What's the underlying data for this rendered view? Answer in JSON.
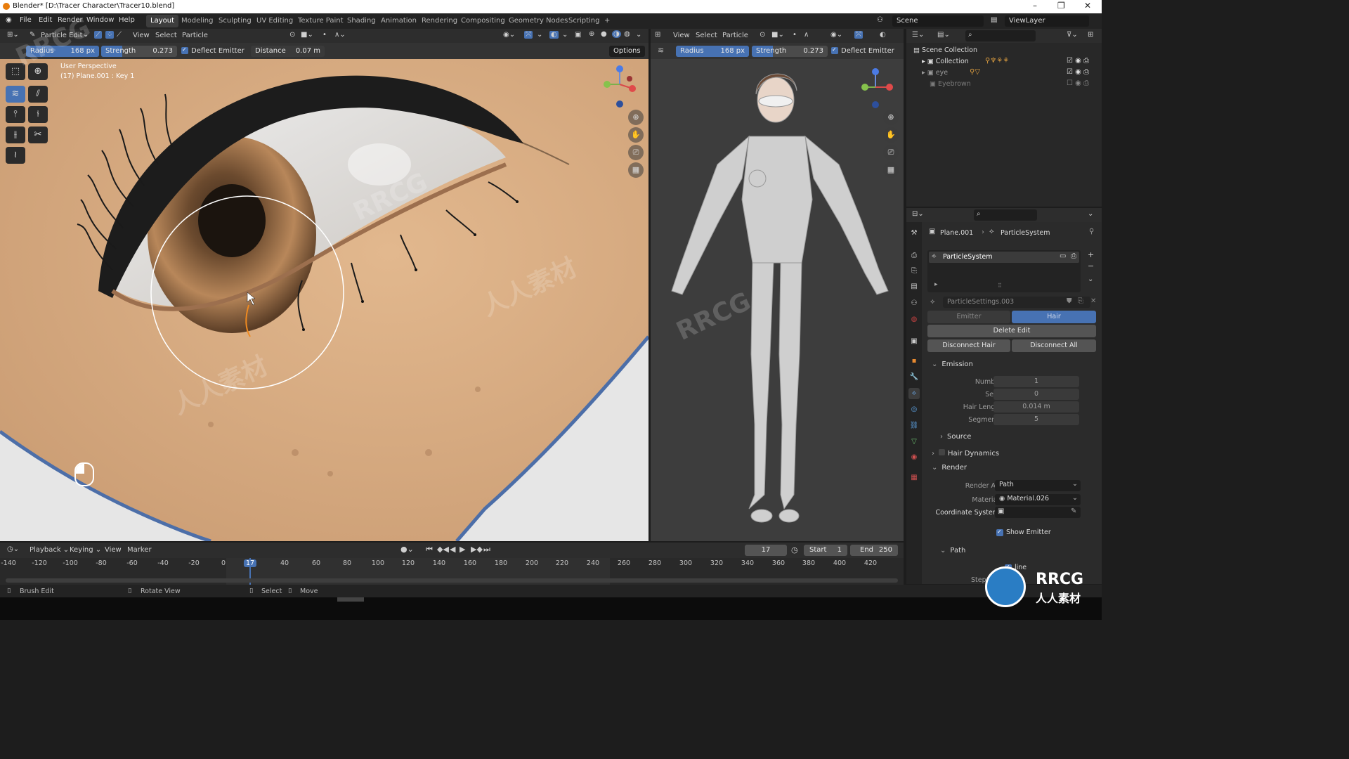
{
  "window": {
    "title": "Blender* [D:\\Tracer Character\\Tracer10.blend]",
    "controls": [
      "–",
      "❐",
      "✕"
    ]
  },
  "menu": {
    "items": [
      "File",
      "Edit",
      "Render",
      "Window",
      "Help"
    ]
  },
  "workspaces": {
    "tabs": [
      "Layout",
      "Modeling",
      "Sculpting",
      "UV Editing",
      "Texture Paint",
      "Shading",
      "Animation",
      "Rendering",
      "Compositing",
      "Geometry Nodes",
      "Scripting"
    ],
    "active": "Layout",
    "add": "+"
  },
  "scene": {
    "label": "Scene",
    "viewlayer": "ViewLayer"
  },
  "left_viewport": {
    "mode": "Particle Edit",
    "header_menus": [
      "View",
      "Select",
      "Particle"
    ],
    "tool_settings": {
      "radius_label": "Radius",
      "radius_value": "168 px",
      "strength_label": "Strength",
      "strength_value": "0.273",
      "deflect_label": "Deflect Emitter",
      "distance_label": "Distance",
      "distance_value": "0.07 m",
      "options": "Options"
    },
    "overlay_text": {
      "line1": "User Perspective",
      "line2": "(17) Plane.001 : Key 1"
    }
  },
  "right_viewport": {
    "header_menus": [
      "View",
      "Select",
      "Particle"
    ],
    "tool_settings": {
      "radius_label": "Radius",
      "radius_value": "168 px",
      "strength_label": "Strength",
      "strength_value": "0.273",
      "deflect_label": "Deflect Emitter"
    }
  },
  "outliner": {
    "items": [
      {
        "label": "Scene Collection",
        "checked": false
      },
      {
        "label": "Collection",
        "checked": true
      },
      {
        "label": "eye",
        "checked": true
      },
      {
        "label": "Eyebrown",
        "checked": false
      }
    ]
  },
  "properties": {
    "breadcrumb": [
      "Plane.001",
      "ParticleSystem"
    ],
    "system_name": "ParticleSystem",
    "settings_name": "ParticleSettings.003",
    "type_tabs": [
      "Emitter",
      "Hair"
    ],
    "active_type": "Hair",
    "buttons": {
      "delete_edit": "Delete Edit",
      "disconnect_hair": "Disconnect Hair",
      "disconnect_all": "Disconnect All"
    },
    "emission": {
      "title": "Emission",
      "fields": [
        {
          "label": "Number",
          "value": "1"
        },
        {
          "label": "Seed",
          "value": "0"
        },
        {
          "label": "Hair Length",
          "value": "0.014 m"
        },
        {
          "label": "Segments",
          "value": "5"
        }
      ]
    },
    "source": "Source",
    "hair_dynamics": "Hair Dynamics",
    "render": {
      "title": "Render",
      "render_as_label": "Render As",
      "render_as_value": "Path",
      "material_label": "Material",
      "material_value": "Material.026",
      "coord_label": "Coordinate System",
      "show_emitter": "Show Emitter"
    },
    "path": {
      "title": "Path",
      "line": "line",
      "steps": "Step"
    }
  },
  "timeline": {
    "menus": [
      "Playback",
      "Keying",
      "View",
      "Marker"
    ],
    "current_frame": "17",
    "start_label": "Start",
    "start_value": "1",
    "end_label": "End",
    "end_value": "250",
    "ticks": [
      "-140",
      "-120",
      "-100",
      "-80",
      "-60",
      "-40",
      "-20",
      "0",
      "17",
      "40",
      "60",
      "80",
      "100",
      "120",
      "140",
      "160",
      "180",
      "200",
      "220",
      "240",
      "260",
      "280",
      "300",
      "320",
      "340",
      "360",
      "380",
      "400",
      "420"
    ]
  },
  "statusbar": {
    "items": [
      "Brush Edit",
      "Rotate View",
      "Select",
      "Move"
    ]
  },
  "watermarks": {
    "brand": "RRCG",
    "cn": "人人素材",
    "logo_text": "RRCG",
    "logo_cn": "人人素材"
  },
  "colors": {
    "accent": "#4772b3",
    "skin": "#d9ae83",
    "viewport_grey": "#3d3d3d",
    "orange": "#e87d0d"
  }
}
